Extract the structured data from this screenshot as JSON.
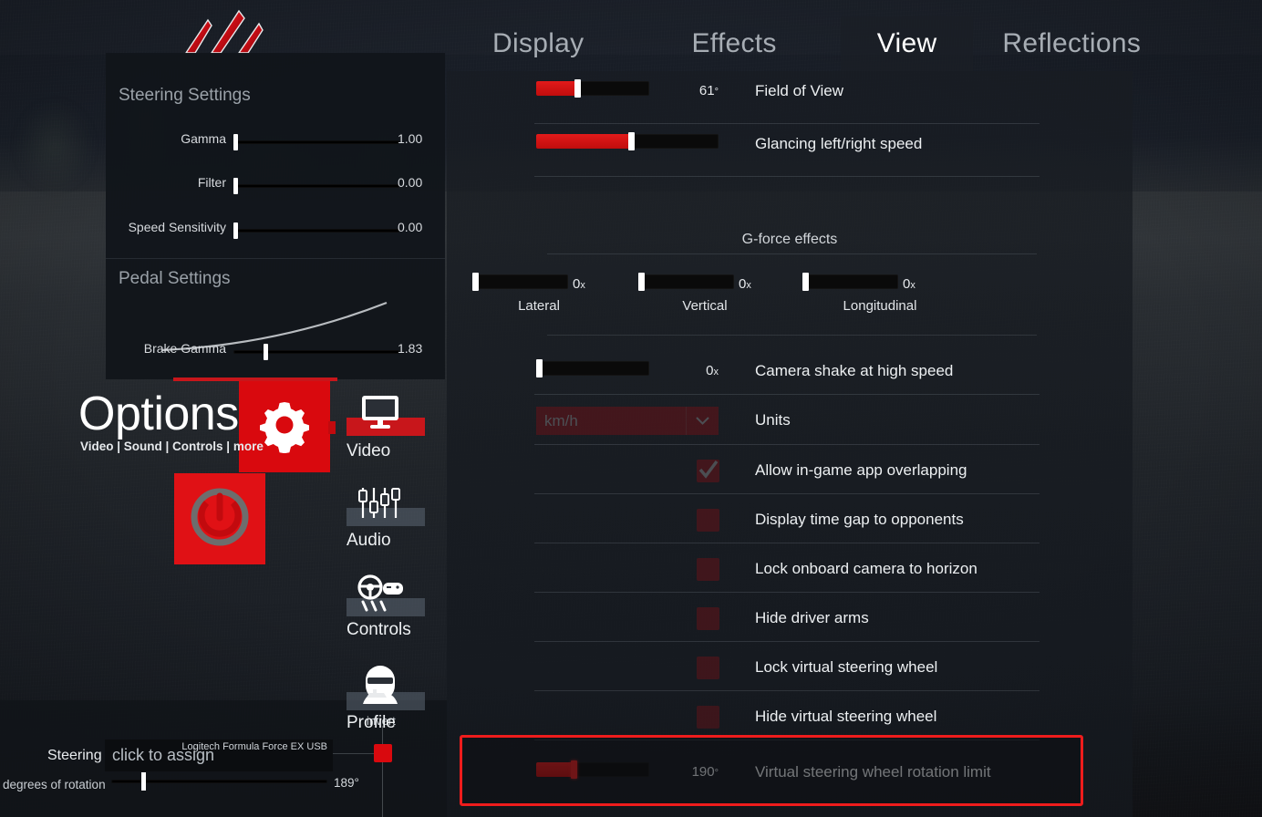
{
  "app": {
    "title": "Assetto Corsa Options",
    "logo_icon": "assetto-corsa-logo"
  },
  "tabs": [
    {
      "label": "Display",
      "active": false
    },
    {
      "label": "Effects",
      "active": false
    },
    {
      "label": "View",
      "active": true
    },
    {
      "label": "Reflections",
      "active": false
    }
  ],
  "view_settings": {
    "field_of_view": {
      "label": "Field of View",
      "value": "61",
      "unit": "°",
      "percent": 36
    },
    "glancing_speed": {
      "label": "Glancing left/right speed",
      "percent": 52
    },
    "gforce": {
      "title": "G-force effects",
      "items": [
        {
          "label": "Lateral",
          "value": "0",
          "unit": "x",
          "percent": 0
        },
        {
          "label": "Vertical",
          "value": "0",
          "unit": "x",
          "percent": 0
        },
        {
          "label": "Longitudinal",
          "value": "0",
          "unit": "x",
          "percent": 0
        }
      ]
    },
    "camera_shake": {
      "label": "Camera shake at high speed",
      "value": "0",
      "unit": "x",
      "percent": 0
    },
    "units": {
      "label": "Units",
      "selected": "km/h",
      "arrow_icon": "chevron-down-icon"
    },
    "checkboxes": [
      {
        "label": "Allow in-game app overlapping",
        "checked": true
      },
      {
        "label": "Display time gap to opponents",
        "checked": false
      },
      {
        "label": "Lock onboard camera to horizon",
        "checked": false
      },
      {
        "label": "Hide driver arms",
        "checked": false
      },
      {
        "label": "Lock virtual steering wheel",
        "checked": false
      },
      {
        "label": "Hide virtual steering wheel",
        "checked": false
      }
    ],
    "rotation_limit": {
      "label": "Virtual steering wheel rotation limit",
      "value": "190",
      "unit": "°",
      "percent": 33,
      "highlighted": true
    }
  },
  "steering_panel": {
    "section1_title": "Steering Settings",
    "section1_rows": [
      {
        "label": "Gamma",
        "value": "1.00",
        "percent": 0
      },
      {
        "label": "Filter",
        "value": "0.00",
        "percent": 0
      },
      {
        "label": "Speed Sensitivity",
        "value": "0.00",
        "percent": 0
      }
    ],
    "section2_title": "Pedal Settings",
    "section2_rows": [
      {
        "label": "Brake Gamma",
        "value": "1.83",
        "percent": 19
      }
    ]
  },
  "options": {
    "title": "Options",
    "subtitle": "Video | Sound | Controls | more",
    "gear_icon": "gear-icon",
    "power_icon": "power-icon"
  },
  "nav": [
    {
      "label": "Video",
      "icon": "monitor-icon",
      "active": true
    },
    {
      "label": "Audio",
      "icon": "sliders-icon",
      "active": false
    },
    {
      "label": "Controls",
      "icon": "wheel-gamepad-icon",
      "active": false
    },
    {
      "label": "Profile",
      "icon": "driver-helmet-icon",
      "active": false
    }
  ],
  "bottom_bar": {
    "steering_label": "Steering",
    "assign_text": "click to assign",
    "device_name": "Logitech Formula Force EX USB",
    "degrees_label": "degrees of rotation",
    "degrees_value": "189°",
    "degrees_percent": 14,
    "invert_label": "invert",
    "invert_checked": false
  },
  "colors": {
    "accent_red": "#d9090e",
    "highlight_red": "#ee1c1c",
    "panel_bg": "#11151a",
    "text_primary": "#edf0f2",
    "text_muted": "#9aa1a8"
  }
}
